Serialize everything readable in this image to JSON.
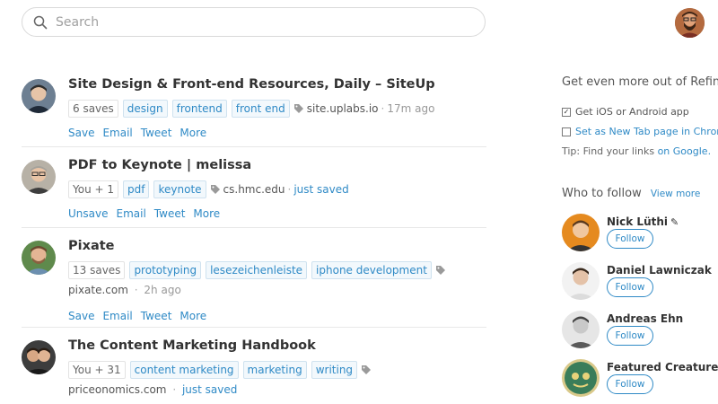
{
  "search": {
    "placeholder": "Search"
  },
  "feed": [
    {
      "title": "Site Design & Front-end Resources, Daily – SiteUp",
      "saves": "6 saves",
      "tags": [
        "design",
        "frontend",
        "front end"
      ],
      "domain": "site.uplabs.io",
      "time": "17m ago",
      "actions": [
        "Save",
        "Email",
        "Tweet",
        "More"
      ]
    },
    {
      "title": "PDF to Keynote | melissa",
      "saves": "You + 1",
      "tags": [
        "pdf",
        "keynote"
      ],
      "domain": "cs.hmc.edu",
      "time": "just saved",
      "actions": [
        "Unsave",
        "Email",
        "Tweet",
        "More"
      ]
    },
    {
      "title": "Pixate",
      "saves": "13 saves",
      "tags": [
        "prototyping",
        "lesezeichenleiste",
        "iphone development"
      ],
      "domain": "pixate.com",
      "time": "2h ago",
      "actions": [
        "Save",
        "Email",
        "Tweet",
        "More"
      ]
    },
    {
      "title": "The Content Marketing Handbook",
      "saves": "You + 31",
      "tags": [
        "content marketing",
        "marketing",
        "writing"
      ],
      "domain": "priceonomics.com",
      "time": "just saved",
      "actions": []
    }
  ],
  "sidebar": {
    "promo_title": "Get even more out of Refind",
    "options": [
      {
        "label": "Get iOS or Android app",
        "checked": true
      },
      {
        "label": "Set as New Tab page in Chrome",
        "checked": false
      }
    ],
    "tip_prefix": "Tip: Find your links",
    "tip_link": "on Google.",
    "who_to_follow": "Who to follow",
    "view_more": "View more",
    "follow_label": "Follow",
    "people": [
      {
        "name": "Nick Lüthi"
      },
      {
        "name": "Daniel Lawniczak"
      },
      {
        "name": "Andreas Ehn"
      },
      {
        "name": "Featured Creature"
      }
    ]
  },
  "colors": {
    "accent": "#2f8ac6",
    "tag_bg": "#f2f8fc",
    "divider": "#e8e8e8"
  }
}
